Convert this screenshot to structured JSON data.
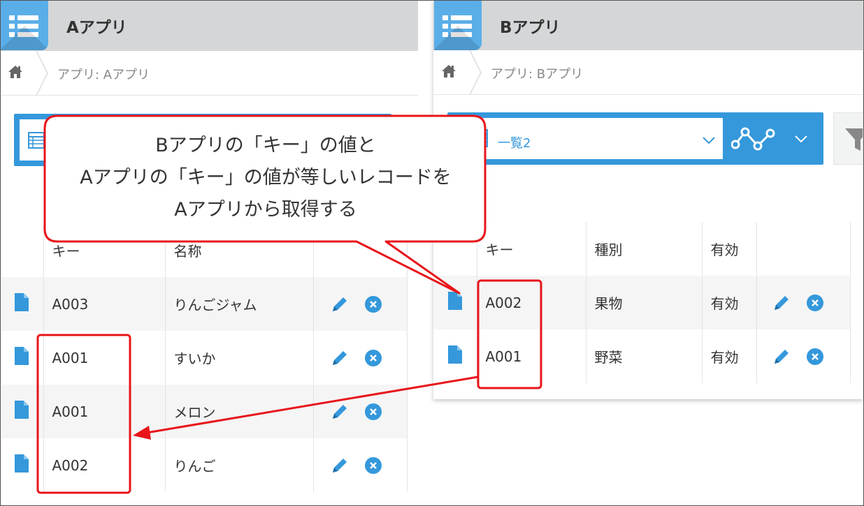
{
  "app_a": {
    "title": "Aアプリ",
    "breadcrumb": "アプリ: Aアプリ",
    "columns": [
      "キー",
      "名称"
    ],
    "rows": [
      {
        "key": "A003",
        "name": "りんごジャム"
      },
      {
        "key": "A001",
        "name": "すいか"
      },
      {
        "key": "A001",
        "name": "メロン"
      },
      {
        "key": "A002",
        "name": "りんご"
      }
    ]
  },
  "app_b": {
    "title": "Bアプリ",
    "breadcrumb": "アプリ: Bアプリ",
    "view_name": "一覧2",
    "columns": [
      "キー",
      "種別",
      "有効"
    ],
    "rows": [
      {
        "key": "A002",
        "type": "果物",
        "valid": "有効"
      },
      {
        "key": "A001",
        "type": "野菜",
        "valid": "有効"
      }
    ]
  },
  "callout": {
    "line1": "Bアプリの「キー」の値と",
    "line2": "Aアプリの「キー」の値が等しいレコードを",
    "line3": "Aアプリから取得する"
  },
  "colors": {
    "accent": "#3498db",
    "highlight": "#e8141a",
    "header_bg": "#d4d6d7"
  },
  "icons": [
    "list-app-icon",
    "home-icon",
    "list-view-icon",
    "chevron-down-icon",
    "graph-icon",
    "filter-icon",
    "record-icon",
    "edit-icon",
    "delete-icon"
  ]
}
